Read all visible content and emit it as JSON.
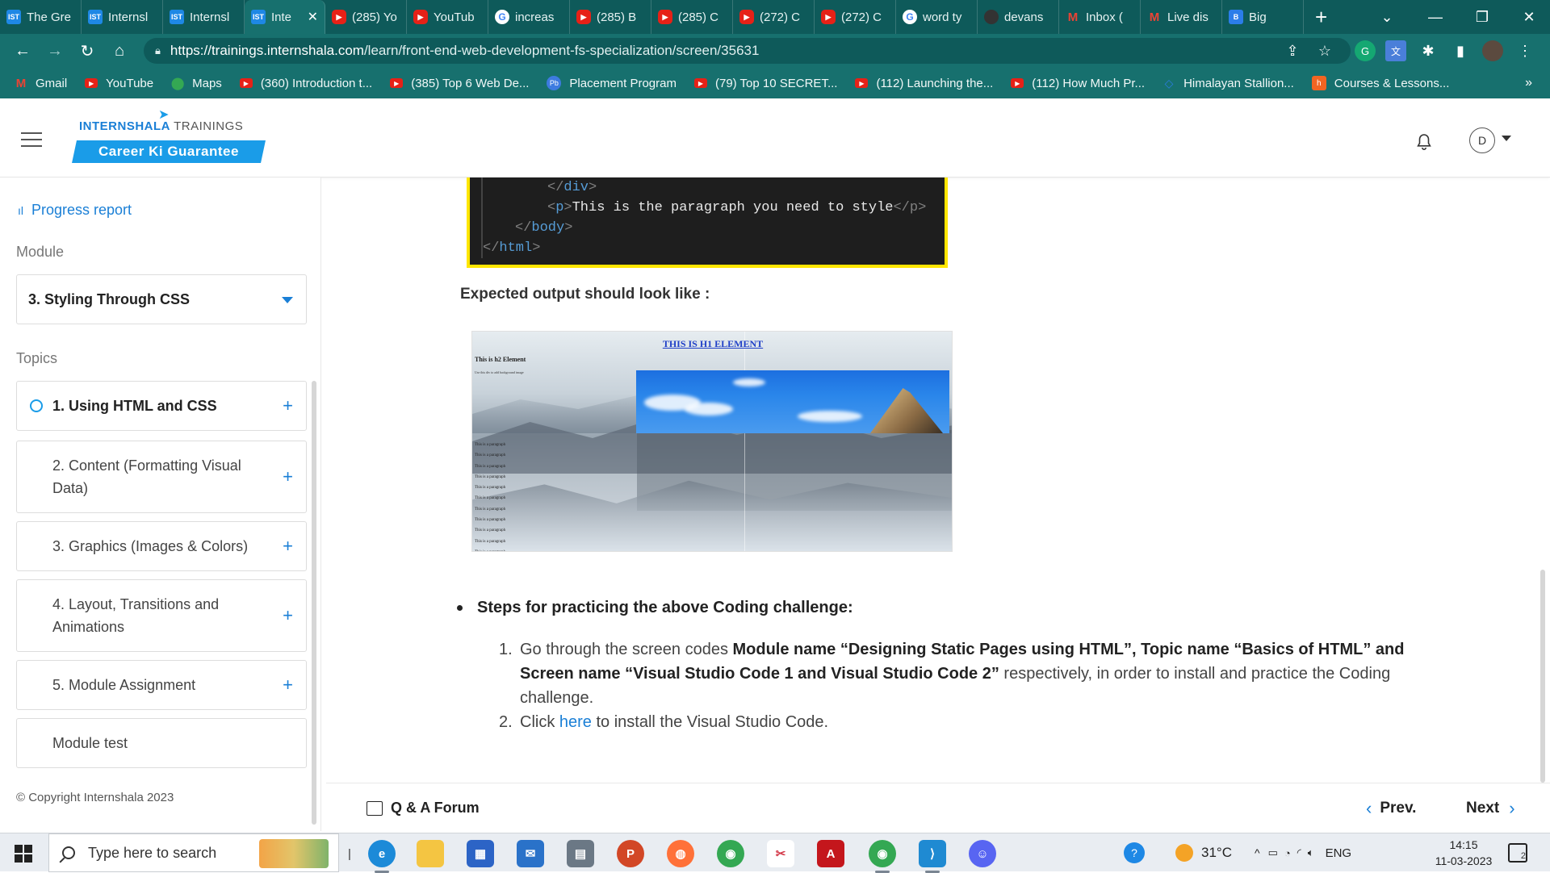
{
  "browser": {
    "tabs": [
      {
        "title": "The Gre",
        "icon": "internshala-icon"
      },
      {
        "title": "Internsl",
        "icon": "internshala-icon"
      },
      {
        "title": "Internsl",
        "icon": "internshala-icon"
      },
      {
        "title": "Inte",
        "icon": "internshala-icon",
        "active": true
      },
      {
        "title": "(285) Yo",
        "icon": "youtube-icon"
      },
      {
        "title": "YouTub",
        "icon": "youtube-icon"
      },
      {
        "title": "increas",
        "icon": "google-icon"
      },
      {
        "title": "(285) B",
        "icon": "youtube-icon"
      },
      {
        "title": "(285) C",
        "icon": "youtube-icon"
      },
      {
        "title": "(272) C",
        "icon": "youtube-icon"
      },
      {
        "title": "(272) C",
        "icon": "youtube-icon"
      },
      {
        "title": "word ty",
        "icon": "google-icon"
      },
      {
        "title": "devans",
        "icon": "github-icon"
      },
      {
        "title": "Inbox (",
        "icon": "gmail-icon"
      },
      {
        "title": "Live dis",
        "icon": "gmail-icon"
      },
      {
        "title": "Big",
        "icon": "bing-icon"
      }
    ],
    "url_host": "https://trainings.internshala.com",
    "url_path": "/learn/front-end-web-development-fs-specialization/screen/35631",
    "bookmarks": [
      {
        "label": "Gmail",
        "icon": "gmail-icon"
      },
      {
        "label": "YouTube",
        "icon": "youtube-icon"
      },
      {
        "label": "Maps",
        "icon": "maps-icon"
      },
      {
        "label": "(360) Introduction t...",
        "icon": "youtube-icon"
      },
      {
        "label": "(385) Top 6 Web De...",
        "icon": "youtube-icon"
      },
      {
        "label": "Placement Program",
        "icon": "placement-icon"
      },
      {
        "label": "(79) Top 10 SECRET...",
        "icon": "youtube-icon"
      },
      {
        "label": "(112) Launching the...",
        "icon": "youtube-icon"
      },
      {
        "label": "(112) How Much Pr...",
        "icon": "youtube-icon"
      },
      {
        "label": "Himalayan Stallion...",
        "icon": "himalayan-icon"
      },
      {
        "label": "Courses & Lessons...",
        "icon": "courses-icon"
      }
    ],
    "bookmarks_more": "»"
  },
  "header": {
    "logo_main": "INTERNSHALA",
    "logo_sub": "TRAININGS",
    "tagline": "Career Ki Guarantee",
    "avatar_initial": "D"
  },
  "sidebar": {
    "progress_label": "Progress report",
    "module_label": "Module",
    "module_selected": "3. Styling Through CSS",
    "topics_label": "Topics",
    "topics": [
      {
        "label": "1. Using HTML and CSS",
        "active": true
      },
      {
        "label": "2. Content (Formatting Visual Data)"
      },
      {
        "label": "3. Graphics (Images & Colors)"
      },
      {
        "label": "4. Layout, Transitions and Animations"
      },
      {
        "label": "5. Module Assignment"
      },
      {
        "label": "Module test"
      }
    ],
    "copyright": "© Copyright Internshala 2023"
  },
  "content": {
    "code_lines": [
      {
        "indent": "        ",
        "open": "</",
        "tag": "div",
        "close": ">",
        "text": "",
        "end": ""
      },
      {
        "indent": "        ",
        "open": "<",
        "tag": "p",
        "close": ">",
        "text": "This is the paragraph you need to style",
        "end": "</p>"
      },
      {
        "indent": "    ",
        "open": "</",
        "tag": "body",
        "close": ">",
        "text": "",
        "end": ""
      },
      {
        "indent": "",
        "open": "</",
        "tag": "html",
        "close": ">",
        "text": "",
        "end": ""
      }
    ],
    "expected_label": "Expected output should look like :",
    "demo": {
      "h1": "THIS IS H1 ELEMENT",
      "h2": "This is h2 Element",
      "sub": "Use this div to add background image",
      "paragraph": "This is a paragraph",
      "paragraph_count": 11
    },
    "steps_heading": "Steps for practicing the above Coding challenge:",
    "steps": {
      "s1_num": "1.",
      "s1_pre": "Go through the screen codes ",
      "s1_bold1": "Module name “Designing Static Pages using HTML”, Topic name “Basics of HTML” and Screen name “Visual Studio Code 1 and Visual Studio Code 2”",
      "s1_post": " respectively, in order to install and practice the Coding challenge.",
      "s2_num": "2.",
      "s2_pre": "Click ",
      "s2_link": "here",
      "s2_post": " to install the Visual Studio Code."
    }
  },
  "footer": {
    "qa_label": "Q & A Forum",
    "prev_label": "Prev.",
    "next_label": "Next"
  },
  "taskbar": {
    "search_placeholder": "Type here to search",
    "temperature": "31°C",
    "language": "ENG",
    "time": "14:15",
    "date": "11-03-2023",
    "notification_count": "2"
  }
}
